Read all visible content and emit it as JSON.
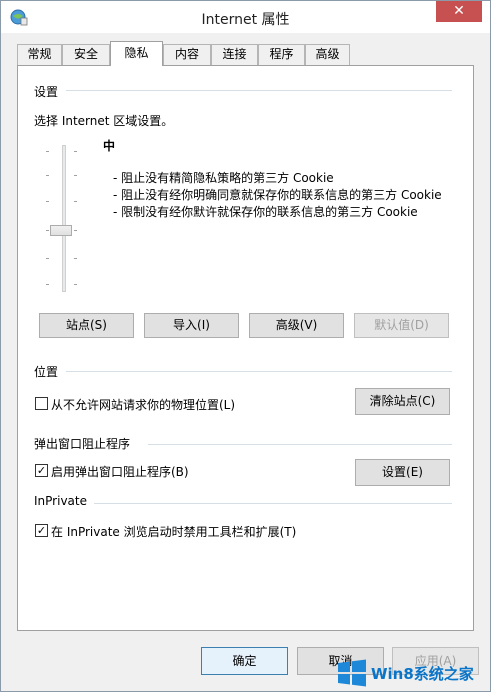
{
  "window": {
    "title": "Internet 属性",
    "close_label": "✕"
  },
  "tabs": [
    {
      "label": "常规"
    },
    {
      "label": "安全"
    },
    {
      "label": "隐私",
      "active": true
    },
    {
      "label": "内容"
    },
    {
      "label": "连接"
    },
    {
      "label": "程序"
    },
    {
      "label": "高级"
    }
  ],
  "settings": {
    "title": "设置",
    "instruction": "选择 Internet 区域设置。",
    "level": "中",
    "bullets": [
      "- 阻止没有精简隐私策略的第三方 Cookie",
      "- 阻止没有经你明确同意就保存你的联系信息的第三方 Cookie",
      "- 限制没有经你默许就保存你的联系信息的第三方 Cookie"
    ],
    "buttons": {
      "sites": "站点(S)",
      "import": "导入(I)",
      "advanced": "高级(V)",
      "default": "默认值(D)"
    }
  },
  "location": {
    "title": "位置",
    "checkbox_label": "从不允许网站请求你的物理位置(L)",
    "checked": false,
    "clear_button": "清除站点(C)"
  },
  "popup": {
    "title": "弹出窗口阻止程序",
    "checkbox_label": "启用弹出窗口阻止程序(B)",
    "checked": true,
    "settings_button": "设置(E)"
  },
  "inprivate": {
    "title": "InPrivate",
    "checkbox_label": "在 InPrivate 浏览启动时禁用工具栏和扩展(T)",
    "checked": true
  },
  "footer": {
    "ok": "确定",
    "cancel": "取消",
    "apply": "应用(A)"
  },
  "watermark": {
    "text": "Win8系统之家"
  },
  "colors": {
    "close": "#c75050",
    "accent": "#3c7fb1",
    "watermark": "#0a74c8"
  }
}
